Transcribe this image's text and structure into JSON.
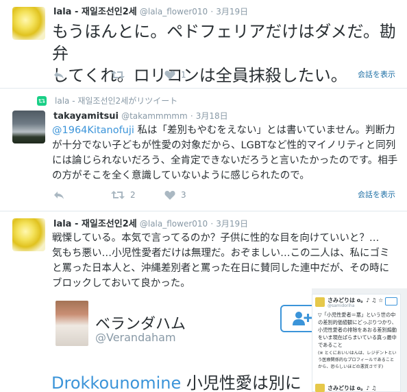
{
  "tweets": [
    {
      "name": "lala - 재일조선인2세",
      "handle": "@lala_flower010",
      "date": "3月19日",
      "lines": [
        "もうほんとに。ペドフェリアだけはダメだ。勘弁",
        "してくれ。ロリコンは全員抹殺したい。"
      ],
      "likes": "1",
      "conversation": "会話を表示"
    },
    {
      "retweet_label": "lala - 재일조선인2세がリツイート",
      "name": "takayamitsui",
      "handle": "@takammmmm",
      "date": "3月18日",
      "mention": "@1964Kitanofuji",
      "line1_rest": " 私は「差別もやむをえない」とは書いていません。判断力",
      "lines": [
        "が十分でない子どもが性愛の対象だから、LGBTなど性的マイノリティと同列",
        "には論じられないだろう、全肯定できないだろうと言いたかったのです。相手",
        "の方がそこを全く意識していないように感じられたので。"
      ],
      "retweets": "2",
      "likes": "3",
      "conversation": "会話を表示"
    },
    {
      "name": "lala - 재일조선인2세",
      "handle": "@lala_flower010",
      "date": "3月19日",
      "lines": [
        "戦慄している。本気で言ってるのか？子供に性的な目を向けていいと？…",
        "気もち悪い…小児性愛者だけは無理だ。おぞましい…この二人は、私にゴミ",
        "と罵った日本人と、沖縄差別者と罵った在日に賛同した連中だが、その時に",
        "ブロックしておいて良かった。"
      ],
      "embed": {
        "name": "ベランダハム",
        "handle": "@Verandaham",
        "bottom_blue": "Drokkounomine",
        "bottom_text": " 小児性愛は別に",
        "overlay": {
          "name": "さみどりは o。♪ ♫ ☆",
          "handle": "@samidoriha",
          "text": "▽「小児性愛者＝悪」という世の中の差別的価値観にどっぷりつかり、小児性愛者の排除をあおる差別煽動をいま現在ばらまいている真っ最中であること",
          "small": "(※ とくにおいいはんは、レジデントという医療関係的なプロフィールであることから、恐らしいほどの悪質さです)",
          "name2": "さみどりは o。♪ ♫"
        }
      }
    }
  ],
  "colors": {
    "link": "#3b94d9",
    "muted": "#8899a6",
    "retweet_green": "#19cf86",
    "border": "#e1e8ed"
  }
}
